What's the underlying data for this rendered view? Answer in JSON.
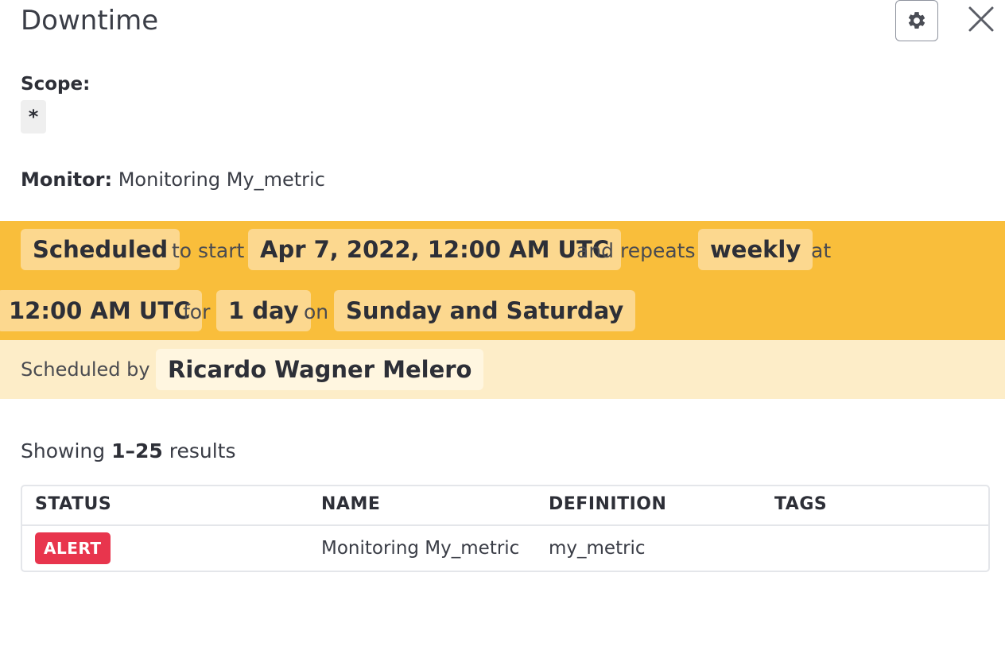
{
  "header": {
    "title": "Downtime",
    "settings_icon": "gear-icon",
    "close_icon": "close-icon"
  },
  "scope": {
    "label": "Scope:",
    "value": "*"
  },
  "monitor": {
    "label": "Monitor:",
    "value": "Monitoring My_metric"
  },
  "schedule": {
    "status": "Scheduled",
    "to_start_text": "to start",
    "start": "Apr 7, 2022, 12:00 AM UTC",
    "and_repeats_text": "and repeats",
    "frequency": "weekly",
    "at_text": "at",
    "time": "12:00 AM UTC",
    "for_text": "for",
    "duration": "1 day",
    "on_text": "on",
    "days": "Sunday and Saturday",
    "scheduled_by_label": "Scheduled by",
    "scheduled_by": "Ricardo Wagner Melero"
  },
  "results": {
    "prefix": "Showing",
    "range": "1–25",
    "suffix": "results"
  },
  "table": {
    "columns": [
      "STATUS",
      "NAME",
      "DEFINITION",
      "TAGS"
    ],
    "rows": [
      {
        "status": "ALERT",
        "name": "Monitoring My_metric",
        "definition": "my_metric",
        "tags": ""
      }
    ]
  },
  "colors": {
    "schedule_band": "#f9be3b",
    "schedule_chip": "#fcd88f",
    "scheduled_by_band": "#fdedc8",
    "alert": "#e8354d"
  }
}
